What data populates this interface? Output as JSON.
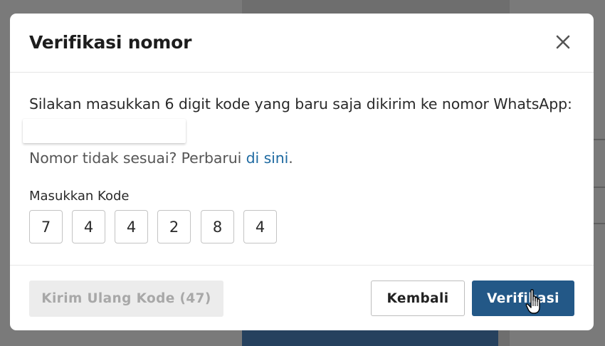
{
  "dialog": {
    "title": "Verifikasi nomor",
    "close_icon": "close-icon",
    "instruction": "Silakan masukkan 6 digit kode yang baru saja dikirim ke nomor WhatsApp:",
    "phone_number": "",
    "mismatch_text": "Nomor tidak sesuai? Perbarui ",
    "mismatch_link": "di sini",
    "mismatch_end": ".",
    "code_label": "Masukkan Kode",
    "code_digits": [
      "7",
      "4",
      "4",
      "2",
      "8",
      "4"
    ]
  },
  "footer": {
    "resend_label": "Kirim Ulang Kode (47)",
    "back_label": "Kembali",
    "verify_label": "Verifikasi"
  },
  "colors": {
    "primary": "#235887",
    "link": "#1e6aa1",
    "disabled_bg": "#ececec",
    "disabled_text": "#a8a8a8"
  }
}
